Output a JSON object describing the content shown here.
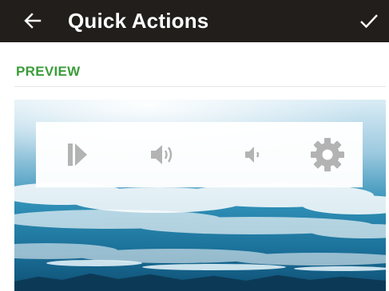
{
  "appbar": {
    "title": "Quick Actions",
    "back_icon": "arrow-left-icon",
    "confirm_icon": "check-icon",
    "background": "#211e1b"
  },
  "preview": {
    "section_label": "PREVIEW",
    "label_color": "#3b9c3b"
  },
  "quick_actions": {
    "icon_color": "#b3b3b3",
    "items": [
      {
        "icon": "skip-forward-icon"
      },
      {
        "icon": "volume-up-icon"
      },
      {
        "icon": "volume-down-icon"
      },
      {
        "icon": "gear-icon"
      }
    ]
  }
}
